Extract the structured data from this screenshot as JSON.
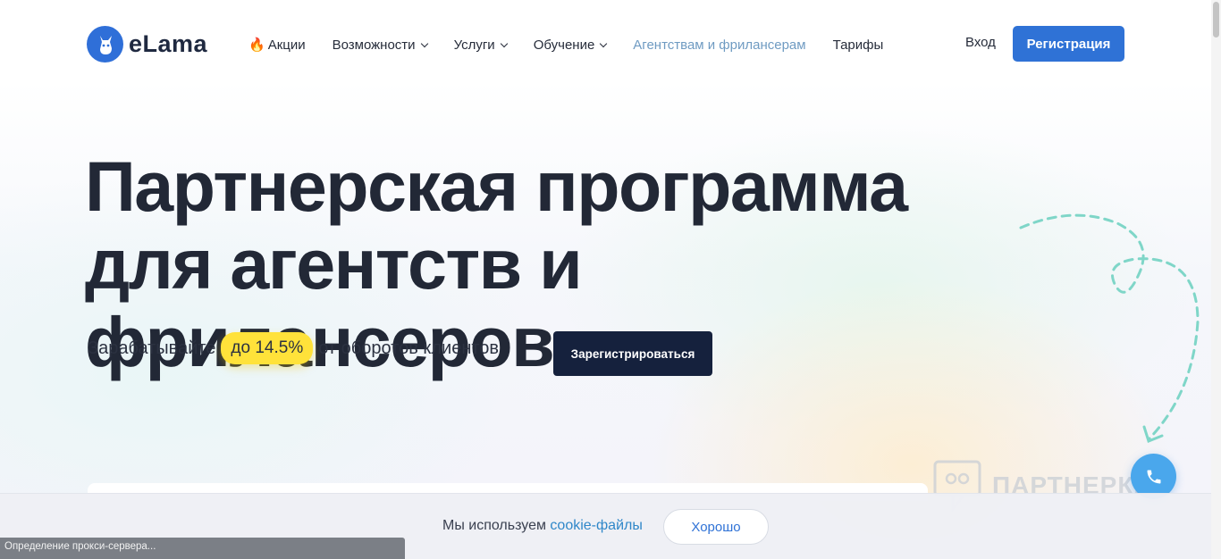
{
  "header": {
    "logo_text": "eLama",
    "nav": [
      {
        "label": "Акции",
        "icon": "fire-icon",
        "dropdown": false,
        "active": false
      },
      {
        "label": "Возможности",
        "dropdown": true,
        "active": false
      },
      {
        "label": "Услуги",
        "dropdown": true,
        "active": false
      },
      {
        "label": "Обучение",
        "dropdown": true,
        "active": false
      },
      {
        "label": "Агентствам и фрилансерам",
        "dropdown": false,
        "active": true
      },
      {
        "label": "Тарифы",
        "dropdown": false,
        "active": false
      }
    ],
    "login_label": "Вход",
    "register_label": "Регистрация"
  },
  "hero": {
    "title_line1": "Партнерская программа",
    "title_line2": "для агентств и фрилансеров",
    "sub_before": "Зарабатывайте",
    "sub_highlight": "до 14.5%",
    "sub_after": "от оборотов клиентов",
    "cta_label": "Зарегистрироваться"
  },
  "watermark": {
    "text": "ПАРТНЕРКИН"
  },
  "cookie": {
    "text": "Мы используем",
    "link": "cookie-файлы",
    "button": "Хорошо"
  },
  "status_bar": {
    "text": "Определение прокси-сервера..."
  },
  "colors": {
    "accent": "#2f72d6",
    "dark": "#15213d",
    "highlight": "#ffe23a",
    "nav_active": "#6f9bc2",
    "deco_dashes": "#7fd6c8"
  }
}
